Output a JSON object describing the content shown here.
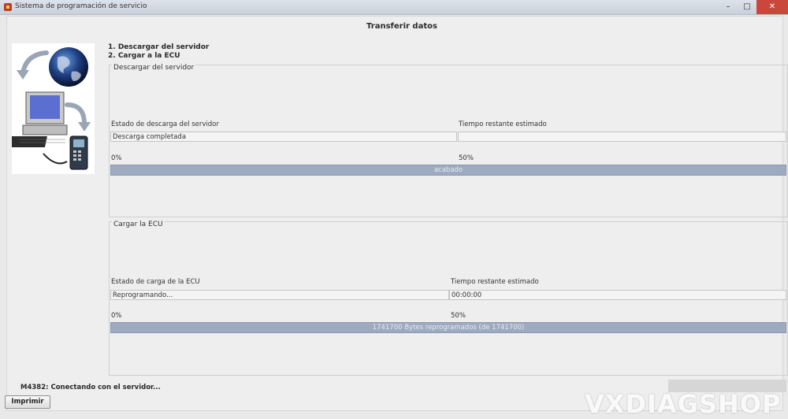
{
  "window": {
    "title": "Sistema de programación de servicio",
    "minimize_glyph": "–",
    "maximize_glyph": "□",
    "close_glyph": "✕"
  },
  "header": {
    "title": "Transferir datos",
    "step1": "1. Descargar del servidor",
    "step2": "2. Cargar a la ECU"
  },
  "download": {
    "group_label": "Descargar del servidor",
    "status_label": "Estado de descarga del servidor",
    "status_value": "Descarga completada",
    "time_label": "Tiempo restante estimado",
    "time_value": "",
    "scale_start": "0%",
    "scale_mid": "50%",
    "progress_percent": 100,
    "progress_text": "acabado"
  },
  "upload": {
    "group_label": "Cargar la ECU",
    "status_label": "Estado de carga de la ECU",
    "status_value": "Reprogramando...",
    "time_label": "Tiempo restante estimado",
    "time_value": "00:00:00",
    "scale_start": "0%",
    "scale_mid": "50%",
    "progress_percent": 100,
    "progress_text": "1741700 Bytes reprogramados (de 1741700)"
  },
  "footer": {
    "status_message": "M4382: Conectando con el servidor...",
    "print_button": "Imprimir"
  },
  "watermark": "VXDIAGSHOP",
  "icons": [
    "app-icon",
    "globe-icon",
    "computer-icon",
    "scan-tool-icon",
    "arrow-icon"
  ],
  "colors": {
    "progress_fill": "#9daac0",
    "progress_border": "#8a98ad",
    "close_button": "#c9473b",
    "background": "#eeeeee"
  }
}
